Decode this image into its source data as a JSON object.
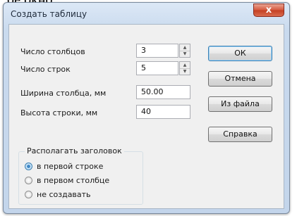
{
  "page_fragment": "ое окно",
  "window": {
    "title": "Создать таблицу",
    "close_glyph": "x"
  },
  "fields": {
    "columns": {
      "label": "Число столбцов",
      "value": "3"
    },
    "rows": {
      "label": "Число строк",
      "value": "5"
    },
    "column_width": {
      "label": "Ширина столбца, мм",
      "value": "50.00"
    },
    "row_height": {
      "label": "Высота строки, мм",
      "value": "40"
    }
  },
  "buttons": {
    "ok": "ОК",
    "cancel": "Отмена",
    "from_file": "Из файла",
    "help": "Справка"
  },
  "header_group": {
    "title": "Располагать заголовок",
    "options": [
      {
        "label": "в первой строке",
        "checked": true
      },
      {
        "label": "в первом столбце",
        "checked": false
      },
      {
        "label": "не создавать",
        "checked": false
      }
    ]
  }
}
